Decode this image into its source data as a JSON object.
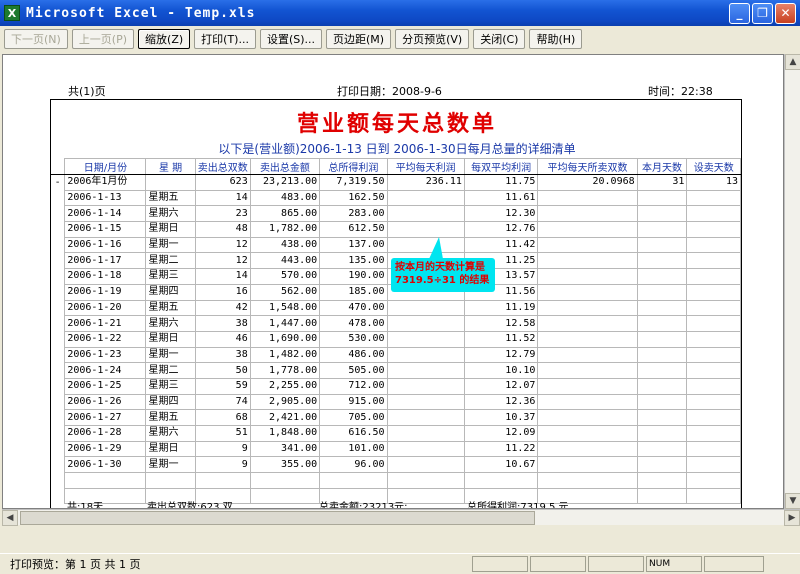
{
  "window": {
    "title": "Microsoft Excel - Temp.xls",
    "app_icon": "X"
  },
  "toolbar": {
    "buttons": [
      {
        "label": "下一页(N)",
        "disabled": true
      },
      {
        "label": "上一页(P)",
        "disabled": true
      },
      {
        "label": "缩放(Z)",
        "pressed": true
      },
      {
        "label": "打印(T)..."
      },
      {
        "label": "设置(S)..."
      },
      {
        "label": "页边距(M)"
      },
      {
        "label": "分页预览(V)"
      },
      {
        "label": "关闭(C)"
      },
      {
        "label": "帮助(H)"
      }
    ]
  },
  "page_header": {
    "pages": "共(1)页",
    "print_date": "打印日期：2008-9-6",
    "time": "时间：22:38"
  },
  "report": {
    "title": "营业额每天总数单",
    "subtitle": "以下是(营业额)2006-1-13  日到  2006-1-30日每月总量的详细清单",
    "headers": [
      "日期/月份",
      "星  期",
      "卖出总双数",
      "卖出总金额",
      "总所得利润",
      "平均每天利润",
      "每双平均利润",
      "平均每天所卖双数",
      "本月天数",
      "设卖天数"
    ],
    "summary_marker": "-",
    "summary": [
      "2006年1月份",
      "",
      "623",
      "23,213.00",
      "7,319.50",
      "236.11",
      "11.75",
      "20.0968",
      "31",
      "13"
    ],
    "rows": [
      [
        "2006-1-13",
        "星期五",
        "14",
        "483.00",
        "162.50",
        "",
        "11.61"
      ],
      [
        "2006-1-14",
        "星期六",
        "23",
        "865.00",
        "283.00",
        "",
        "12.30"
      ],
      [
        "2006-1-15",
        "星期日",
        "48",
        "1,782.00",
        "612.50",
        "",
        "12.76"
      ],
      [
        "2006-1-16",
        "星期一",
        "12",
        "438.00",
        "137.00",
        "",
        "11.42"
      ],
      [
        "2006-1-17",
        "星期二",
        "12",
        "443.00",
        "135.00",
        "",
        "11.25"
      ],
      [
        "2006-1-18",
        "星期三",
        "14",
        "570.00",
        "190.00",
        "",
        "13.57"
      ],
      [
        "2006-1-19",
        "星期四",
        "16",
        "562.00",
        "185.00",
        "",
        "11.56"
      ],
      [
        "2006-1-20",
        "星期五",
        "42",
        "1,548.00",
        "470.00",
        "",
        "11.19"
      ],
      [
        "2006-1-21",
        "星期六",
        "38",
        "1,447.00",
        "478.00",
        "",
        "12.58"
      ],
      [
        "2006-1-22",
        "星期日",
        "46",
        "1,690.00",
        "530.00",
        "",
        "11.52"
      ],
      [
        "2006-1-23",
        "星期一",
        "38",
        "1,482.00",
        "486.00",
        "",
        "12.79"
      ],
      [
        "2006-1-24",
        "星期二",
        "50",
        "1,778.00",
        "505.00",
        "",
        "10.10"
      ],
      [
        "2006-1-25",
        "星期三",
        "59",
        "2,255.00",
        "712.00",
        "",
        "12.07"
      ],
      [
        "2006-1-26",
        "星期四",
        "74",
        "2,905.00",
        "915.00",
        "",
        "12.36"
      ],
      [
        "2006-1-27",
        "星期五",
        "68",
        "2,421.00",
        "705.00",
        "",
        "10.37"
      ],
      [
        "2006-1-28",
        "星期六",
        "51",
        "1,848.00",
        "616.50",
        "",
        "12.09"
      ],
      [
        "2006-1-29",
        "星期日",
        "9",
        "341.00",
        "101.00",
        "",
        "11.22"
      ],
      [
        "2006-1-30",
        "星期一",
        "9",
        "355.00",
        "96.00",
        "",
        "10.67"
      ]
    ],
    "footer": {
      "days": "共:18天",
      "pairs": "卖出总双数:623  双",
      "amount": "总卖金额:23213元;",
      "profit": "总所得利润:7319.5  元"
    },
    "callout": "按本月的天数计算是7319.5÷31 的结果",
    "colors": {
      "title": "#e00000",
      "header_text": "#1a38a8",
      "callout_bg": "#00e5f0"
    }
  },
  "status_bar": {
    "text": "打印预览：第 1 页  共 1 页",
    "num": "NUM"
  }
}
